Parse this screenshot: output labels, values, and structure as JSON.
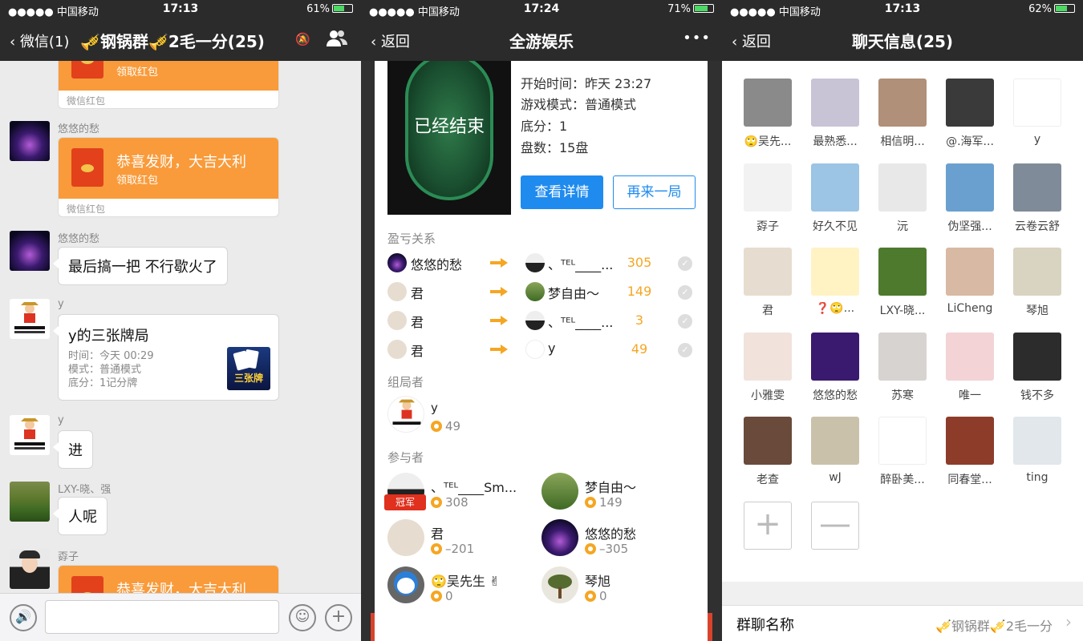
{
  "colors": {
    "accent": "#1f8bef",
    "orange": "#f99b3b",
    "gold": "#f5a623",
    "nav": "#2b2b2b"
  },
  "p1": {
    "status": {
      "carrier": "●●●●● 中国移动",
      "time": "17:13",
      "battery": "61%",
      "battery_fill": 0.61
    },
    "nav": {
      "back": "微信(1)",
      "title": "🎺钢锅群🎺2毛一分(25)"
    },
    "messages": {
      "m0": {
        "take": "领取红包",
        "brand": "微信红包"
      },
      "m1": {
        "sender": "悠悠的愁",
        "wish": "恭喜发财，大吉大利",
        "take": "领取红包",
        "brand": "微信红包"
      },
      "m2": {
        "sender": "悠悠的愁",
        "text": "最后搞一把 不行歇火了"
      },
      "m3": {
        "sender": "y",
        "title": "y的三张牌局",
        "time": "时间：今天 00:29",
        "mode": "模式：普通模式",
        "base": "底分：1记分牌",
        "logo": "三张牌"
      },
      "m4": {
        "sender": "y",
        "text": "进"
      },
      "m5": {
        "sender": "LXY-晓、强",
        "text": "人呢"
      },
      "m6": {
        "sender": "孬子",
        "wish": "恭喜发财，大吉大利"
      }
    },
    "inputbar": {
      "voice_icon": "voice-icon",
      "emoji_icon": "emoji-icon",
      "plus_icon": "plus-icon"
    }
  },
  "p2": {
    "status": {
      "carrier": "●●●●● 中国移动",
      "time": "17:24",
      "battery": "71%",
      "battery_fill": 0.71
    },
    "nav": {
      "back": "返回",
      "title": "全游娱乐",
      "more": "•••"
    },
    "game": {
      "ended": "已经结束",
      "start": "开始时间：昨天 23:27",
      "mode": "游戏模式：普通模式",
      "base": "底分：1",
      "rounds": "盘数：15盘",
      "detail_btn": "查看详情",
      "again_btn": "再来一局"
    },
    "relation_title": "盈亏关系",
    "relations": [
      {
        "from": "悠悠的愁",
        "to": "、ᵀᴱᴸ____...",
        "amount": "305"
      },
      {
        "from": "君",
        "to": "梦自由～",
        "amount": "149"
      },
      {
        "from": "君",
        "to": "、ᵀᴱᴸ____...",
        "amount": "3"
      },
      {
        "from": "君",
        "to": "y",
        "amount": "49"
      }
    ],
    "organizer_title": "组局者",
    "organizer": {
      "name": "y",
      "score": "49"
    },
    "participants_title": "参与者",
    "champion_badge": "冠军",
    "participants": [
      {
        "name": "、ᵀᴱᴸ____Sm...",
        "score": "308"
      },
      {
        "name": "梦自由～",
        "score": "149"
      },
      {
        "name": "君",
        "score": "–201"
      },
      {
        "name": "悠悠的愁",
        "score": "–305"
      },
      {
        "name": "🙄吴先生 ✌",
        "score": "0"
      },
      {
        "name": "琴旭",
        "score": "0"
      }
    ]
  },
  "p3": {
    "status": {
      "carrier": "●●●●● 中国移动",
      "time": "17:13",
      "battery": "62%",
      "battery_fill": 0.62
    },
    "nav": {
      "back": "返回",
      "title": "聊天信息(25)"
    },
    "members": [
      "🙄吴先...",
      "最熟悉...",
      "相信明...",
      "@.海军...",
      "y",
      "孬子",
      "好久不见",
      "沅",
      "伪坚强...",
      "云卷云舒",
      "君",
      "❓🙄...",
      "LXY-晓...",
      "LiCheng",
      "琴旭",
      "小雅雯",
      "悠悠的愁",
      "苏寒",
      "唯一",
      "钱不多",
      "老查",
      "wJ",
      "醉卧美...",
      "同春堂...",
      "ting"
    ],
    "add": "+",
    "remove": "—",
    "group_name_label": "群聊名称",
    "group_name_value": "🎺钢锅群🎺2毛一分"
  }
}
